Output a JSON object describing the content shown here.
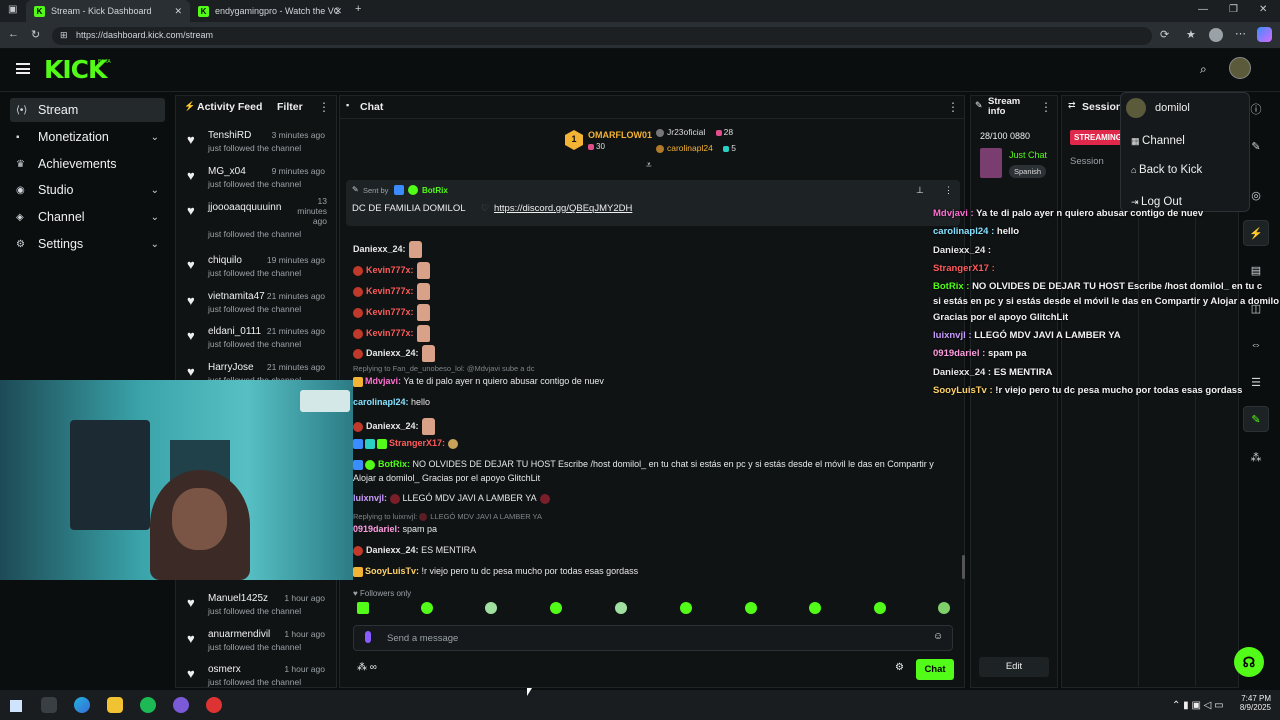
{
  "browser": {
    "tabs": [
      {
        "title": "Stream - Kick Dashboard",
        "active": true
      },
      {
        "title": "endygamingpro - Watch the VOD",
        "active": false
      }
    ],
    "url": "https://dashboard.kick.com/stream"
  },
  "brand": {
    "logo": "KICK",
    "badge": "BETA",
    "accent": "#53fc18"
  },
  "sidebar": {
    "items": [
      {
        "label": "Stream",
        "icon": "stream-icon",
        "selected": true,
        "chevron": false
      },
      {
        "label": "Monetization",
        "icon": "money-icon",
        "chevron": true
      },
      {
        "label": "Achievements",
        "icon": "trophy-icon",
        "chevron": false
      },
      {
        "label": "Studio",
        "icon": "studio-icon",
        "chevron": true
      },
      {
        "label": "Channel",
        "icon": "channel-icon",
        "chevron": true
      },
      {
        "label": "Settings",
        "icon": "gear-icon",
        "chevron": true
      }
    ]
  },
  "activity": {
    "title": "Activity Feed",
    "filter": "Filter",
    "items": [
      {
        "name": "TenshiRD",
        "time": "3 minutes ago",
        "sub": "just followed the channel"
      },
      {
        "name": "MG_x04",
        "time": "9 minutes ago",
        "sub": "just followed the channel"
      },
      {
        "name": "jjoooaaqquuuinn",
        "time": "13 minutes ago",
        "sub": "just followed the channel"
      },
      {
        "name": "chiquilo",
        "time": "19 minutes ago",
        "sub": "just followed the channel"
      },
      {
        "name": "vietnamita47",
        "time": "21 minutes ago",
        "sub": "just followed the channel"
      },
      {
        "name": "eldani_0111",
        "time": "21 minutes ago",
        "sub": "just followed the channel"
      },
      {
        "name": "HarryJose",
        "time": "21 minutes ago",
        "sub": "just followed the channel"
      },
      {
        "name": "Manuel1425z",
        "time": "1 hour ago",
        "sub": "just followed the channel"
      },
      {
        "name": "anuarmendivil",
        "time": "1 hour ago",
        "sub": "just followed the channel"
      },
      {
        "name": "osmerx",
        "time": "1 hour ago",
        "sub": "just followed the channel"
      }
    ]
  },
  "chat": {
    "title": "Chat",
    "leaderboard": [
      {
        "rank": "1",
        "name": "OMARFLOW01",
        "count": "30"
      },
      {
        "name": "Jr23oficial",
        "count": "28"
      },
      {
        "name": "carolinapl24",
        "count": "5"
      }
    ],
    "pinned": {
      "sent_by": "Sent by",
      "author": "BotRix",
      "text": "DC DE FAMILIA DOMILOL",
      "link": "https://discord.gg/QBEqJMY2DH"
    },
    "messages": [
      {
        "user": "Daniexx_24:",
        "color": "#e8e8e8",
        "text": ""
      },
      {
        "user": "Kevin777x:",
        "color": "#ff5a5a",
        "text": ""
      },
      {
        "user": "Kevin777x:",
        "color": "#ff5a5a",
        "text": ""
      },
      {
        "user": "Kevin777x:",
        "color": "#ff5a5a",
        "text": ""
      },
      {
        "user": "Kevin777x:",
        "color": "#ff5a5a",
        "text": ""
      },
      {
        "user": "Daniexx_24:",
        "color": "#e8e8e8",
        "text": ""
      }
    ],
    "reply1": "Replying to Fan_de_unobeso_lol: @Mdvjavi sube a dc",
    "m_mdv": {
      "user": "Mdvjavi:",
      "text": "Ya te di palo ayer n quiero abusar contigo de nuev"
    },
    "m_carol": {
      "user": "carolinapl24:",
      "text": "hello"
    },
    "m_dani2": {
      "user": "Daniexx_24:",
      "text": ""
    },
    "m_stranger": {
      "user": "StrangerX17:",
      "text": ""
    },
    "m_botrix": {
      "user": "BotRix:",
      "text": "NO OLVIDES DE DEJAR TU HOST Escribe /host domilol_ en tu chat si estás en pc y si estás desde el móvil le das en Compartir y",
      "text2": "Alojar a domilol_ Gracias por el apoyo GlitchLit"
    },
    "m_luix": {
      "user": "luixnvjl:",
      "text": "LLEGÓ MDV JAVI A LAMBER YA"
    },
    "reply2": "Replying to luixnvjl:",
    "reply2b": "LLEGÓ MDV JAVI A LAMBER YA",
    "m_dariel": {
      "user": "0919dariel:",
      "text": "spam pa"
    },
    "m_dani3": {
      "user": "Daniexx_24:",
      "text": "ES MENTIRA"
    },
    "m_sooy": {
      "user": "SooyLuisTv:",
      "text": "!r viejo pero tu dc pesa mucho por todas esas gordass"
    },
    "followers_only": "Followers only",
    "placeholder": "Send a message",
    "send": "Chat"
  },
  "streaminfo": {
    "title": "Stream info",
    "counter": "28/100 0880",
    "category": "Just Chat",
    "language": "Spanish",
    "edit": "Edit"
  },
  "session": {
    "title": "Session",
    "badge": "STREAMING",
    "label": "Session"
  },
  "usermenu": {
    "user": "domilol",
    "items": [
      "Channel",
      "Back to Kick",
      "Log Out"
    ]
  },
  "overlay": [
    {
      "user": "Mdvjavi :",
      "color": "#ff6fd1",
      "text": "Ya te di palo ayer n quiero abusar contigo de nuev"
    },
    {
      "user": "carolinapl24 :",
      "color": "#86e2ff",
      "text": "hello"
    },
    {
      "user": "Daniexx_24 :",
      "color": "#e8e8e8",
      "text": ""
    },
    {
      "user": "StrangerX17 :",
      "color": "#ff5a5a",
      "text": ""
    },
    {
      "user": "BotRix :",
      "color": "#53fc18",
      "text": "NO OLVIDES DE DEJAR TU HOST Escribe /host domilol_ en tu c"
    },
    {
      "user": "",
      "color": "#f2f2f2",
      "text": "si estás en pc y si estás desde el móvil le das en Compartir y Alojar a domilo"
    },
    {
      "user": "",
      "color": "#f2f2f2",
      "text": "Gracias por el apoyo GlitchLit"
    },
    {
      "user": "luixnvjl :",
      "color": "#c89cff",
      "text": "LLEGÓ MDV JAVI A LAMBER YA"
    },
    {
      "user": "0919dariel :",
      "color": "#ff9de0",
      "text": "spam pa"
    },
    {
      "user": "Daniexx_24 :",
      "color": "#e8e8e8",
      "text": "ES MENTIRA"
    },
    {
      "user": "SooyLuisTv :",
      "color": "#ffd36b",
      "text": "!r viejo pero tu dc pesa mucho por todas esas gordass"
    }
  ],
  "taskbar": {
    "time": "7:47 PM",
    "date": "8/9/2025"
  }
}
